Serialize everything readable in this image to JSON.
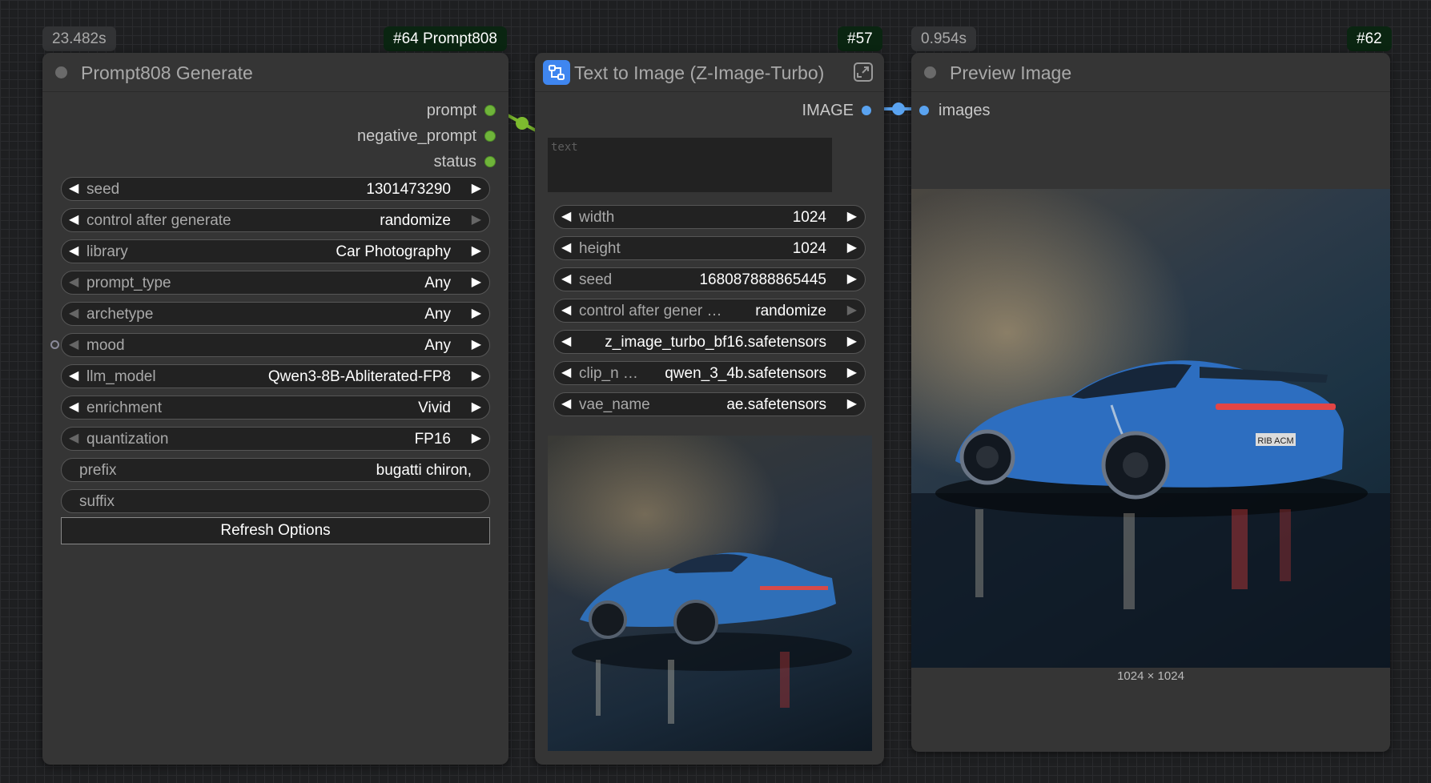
{
  "badges": {
    "n64_time": "23.482s",
    "n64_id": "#64 Prompt808",
    "n57_id": "#57",
    "n62_time": "0.954s",
    "n62_id": "#62"
  },
  "prompt808_node": {
    "title": "Prompt808 Generate",
    "outputs": [
      "prompt",
      "negative_prompt",
      "status"
    ],
    "widgets": [
      {
        "label": "seed",
        "value": "1301473290"
      },
      {
        "label": "control after generate",
        "value": "randomize"
      },
      {
        "label": "library",
        "value": "Car Photography"
      },
      {
        "label": "prompt_type",
        "value": "Any"
      },
      {
        "label": "archetype",
        "value": "Any"
      },
      {
        "label": "mood",
        "value": "Any"
      },
      {
        "label": "llm_model",
        "value": "Qwen3-8B-Abliterated-FP8"
      },
      {
        "label": "enrichment",
        "value": "Vivid"
      },
      {
        "label": "quantization",
        "value": "FP16"
      }
    ],
    "prefix": {
      "label": "prefix",
      "value": "bugatti chiron,"
    },
    "suffix": {
      "label": "suffix",
      "value": ""
    },
    "refresh_label": "Refresh Options"
  },
  "t2i_node": {
    "title": "Text to Image (Z-Image-Turbo)",
    "output_label": "IMAGE",
    "text_placeholder": "text",
    "widgets": [
      {
        "label": "width",
        "value": "1024"
      },
      {
        "label": "height",
        "value": "1024"
      },
      {
        "label": "seed",
        "value": "168087888865445"
      },
      {
        "label": "control after gener …",
        "value": "randomize"
      },
      {
        "label": "",
        "value": "z_image_turbo_bf16.safetensors"
      },
      {
        "label": "clip_n …",
        "value": "qwen_3_4b.safetensors"
      },
      {
        "label": "vae_name",
        "value": "ae.safetensors"
      }
    ]
  },
  "preview_node": {
    "title": "Preview Image",
    "input_label": "images",
    "dimensions": "1024 × 1024"
  },
  "colors": {
    "canvas": "#1e1f21",
    "node_bg": "#353535",
    "widget_bg": "#222222",
    "link_green": "#7dbb2f",
    "link_blue": "#5aa3f0",
    "badge_id_bg": "#0a2511"
  },
  "icons": [
    "workflow-icon",
    "expand-icon",
    "arrow-left-icon",
    "arrow-right-icon"
  ]
}
